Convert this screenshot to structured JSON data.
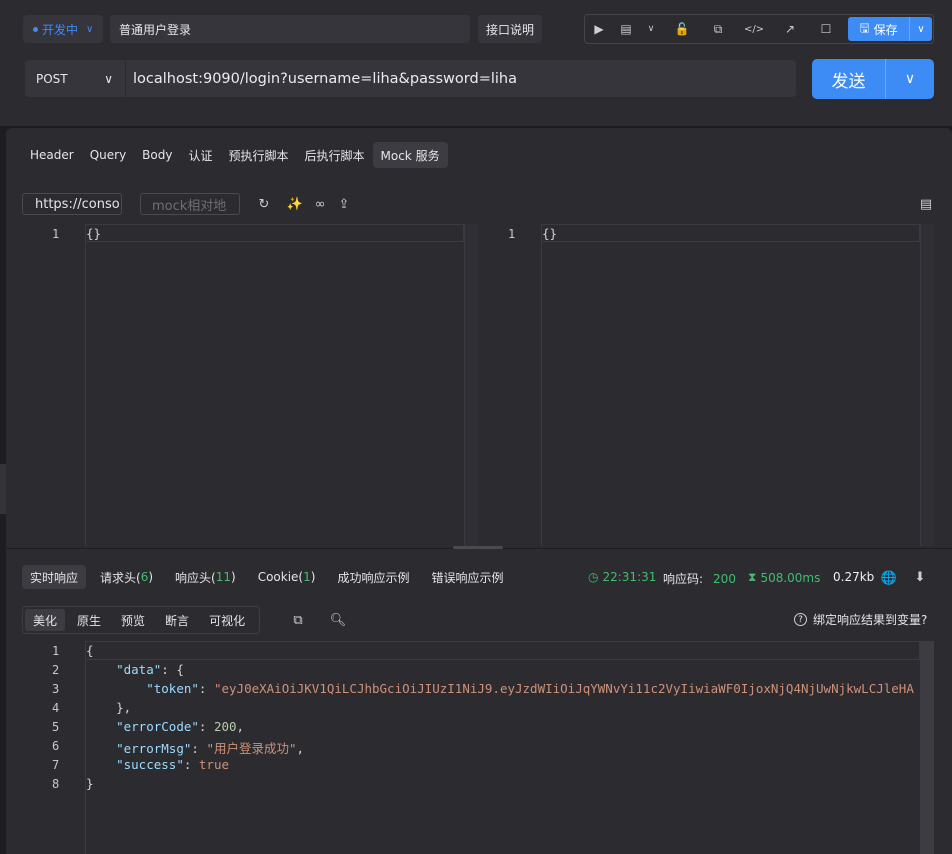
{
  "header": {
    "env_label": "开发中",
    "api_name": "普通用户登录",
    "doc_button": "接口说明",
    "save_label": "保存",
    "method": "POST",
    "url": "localhost:9090/login?username=liha&password=liha",
    "send_label": "发送"
  },
  "request_tabs": [
    "Header",
    "Query",
    "Body",
    "认证",
    "预执行脚本",
    "后执行脚本",
    "Mock 服务"
  ],
  "mock": {
    "url_value": "https://conso",
    "relative_placeholder": "mock相对地",
    "left_editor": {
      "line": "1",
      "code": "{}"
    },
    "right_editor": {
      "line": "1",
      "code": "{}"
    }
  },
  "response": {
    "tabs": {
      "realtime": "实时响应",
      "req_headers": "请求头(",
      "req_headers_count": "6",
      "res_headers": "响应头(",
      "res_headers_count": "11",
      "cookie": "Cookie(",
      "cookie_count": "1",
      "close_paren": ")",
      "success_example": "成功响应示例",
      "error_example": "错误响应示例"
    },
    "time": "22:31:31",
    "status_label": "响应码:",
    "status_code": "200",
    "duration": "508.00ms",
    "size": "0.27kb",
    "view_tabs": [
      "美化",
      "原生",
      "预览",
      "断言",
      "可视化"
    ],
    "bind_question": "绑定响应结果到变量?",
    "body_lines": [
      {
        "n": "1",
        "indent": "",
        "parts": [
          [
            "p",
            "{"
          ]
        ]
      },
      {
        "n": "2",
        "indent": "    ",
        "parts": [
          [
            "k",
            "\"data\""
          ],
          [
            "p",
            ": {"
          ]
        ]
      },
      {
        "n": "3",
        "indent": "        ",
        "parts": [
          [
            "k",
            "\"token\""
          ],
          [
            "p",
            ": "
          ],
          [
            "s",
            "\"eyJ0eXAiOiJKV1QiLCJhbGciOiJIUzI1NiJ9.eyJzdWIiOiJqYWNvYi11c2VyIiwiaWF0IjoxNjQ4NjUwNjkwLCJleHA"
          ]
        ]
      },
      {
        "n": "4",
        "indent": "    ",
        "parts": [
          [
            "p",
            "},"
          ]
        ]
      },
      {
        "n": "5",
        "indent": "    ",
        "parts": [
          [
            "k",
            "\"errorCode\""
          ],
          [
            "p",
            ": "
          ],
          [
            "n",
            "200"
          ],
          [
            "p",
            ","
          ]
        ]
      },
      {
        "n": "6",
        "indent": "    ",
        "parts": [
          [
            "k",
            "\"errorMsg\""
          ],
          [
            "p",
            ": "
          ],
          [
            "s",
            "\"用户登录成功\""
          ],
          [
            "p",
            ","
          ]
        ]
      },
      {
        "n": "7",
        "indent": "    ",
        "parts": [
          [
            "k",
            "\"success\""
          ],
          [
            "p",
            ": "
          ],
          [
            "b",
            "true"
          ]
        ]
      },
      {
        "n": "8",
        "indent": "",
        "parts": [
          [
            "p",
            "}"
          ]
        ]
      }
    ]
  },
  "colors": {
    "accent": "#3d8bf5",
    "success": "#3fbf6e",
    "json_key": "#9cdcfe",
    "json_string": "#ce9178",
    "json_number": "#b5cea8"
  }
}
